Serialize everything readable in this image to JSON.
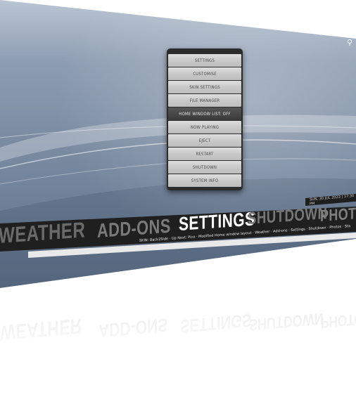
{
  "menu": {
    "items": [
      "SETTINGS",
      "CUSTOMISE",
      "SKIN SETTINGS",
      "FILE MANAGER",
      "HOME WINDOW LIST: OFF",
      "NOW PLAYING",
      "EJECT",
      "RESTART",
      "SHUTDOWN",
      "SYSTEM INFO"
    ],
    "active_index": 4
  },
  "status": {
    "text": "SUN, 30 JUL 2023 | 17:30 PM"
  },
  "home": {
    "items": [
      "WEATHER",
      "ADD-ONS",
      "SETTINGS",
      "SHUTDOWN",
      "PHOTOS"
    ],
    "selected": "SETTINGS",
    "ticker": "SKIN: Back2Side · Up Next: Pico · Modified Home window layout · Weather · Add-ons · Settings · Shutdown · Photos · Status · Notifications"
  },
  "icons": {
    "search": "search-icon"
  },
  "colors": {
    "screen_top": "#b9c5d3",
    "screen_bottom": "#5f7088",
    "bar": "#1f1f1f",
    "menu_bg": "#2c2c2c",
    "active": "#3a3a3a"
  }
}
